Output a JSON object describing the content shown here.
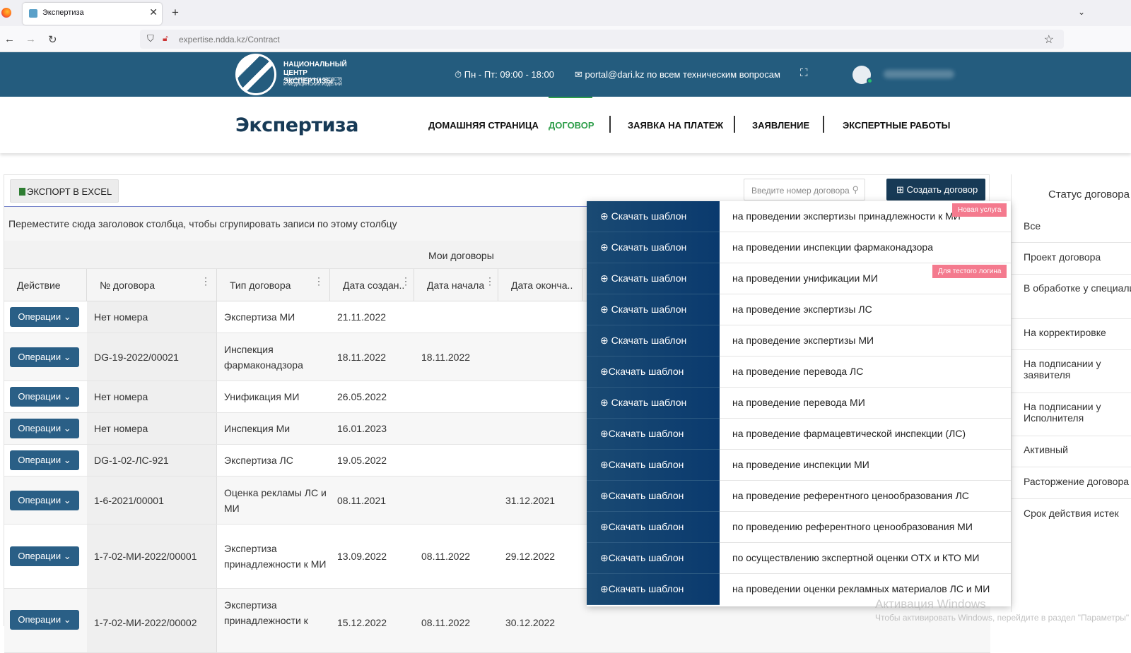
{
  "browser": {
    "tab_title": "Экспертиза",
    "url": "expertise.ndda.kz/Contract"
  },
  "header": {
    "logo_line1": "НАЦИОНАЛЬНЫЙ",
    "logo_line2": "ЦЕНТР ЭКСПЕРТИЗЫ",
    "logo_line3": "ЛЕКАРСТВЕННЫХ СРЕДСТВ",
    "logo_line4": "И МЕДИЦИНСКИХ ИЗДЕЛИЙ",
    "hours": "Пн - Пт: 09:00 - 18:00",
    "email": "portal@dari.kz по всем техническим вопросам"
  },
  "nav": {
    "brand": "Экспертиза",
    "items": [
      "ДОМАШНЯЯ СТРАНИЦА",
      "ДОГОВОР",
      "ЗАЯВКА НА ПЛАТЕЖ",
      "ЗАЯВЛЕНИЕ",
      "ЭКСПЕРТНЫЕ РАБОТЫ"
    ],
    "active": "ДОГОВОР",
    "active_color": "#2e9e4a"
  },
  "toolbar": {
    "export_label": "ЭКСПОРТ В EXCEL",
    "search_placeholder": "Введите номер договора",
    "create_label": "Создать договор"
  },
  "grid": {
    "group_hint": "Переместите сюда заголовок столбца, чтобы сгрупировать записи по этому столбцу",
    "caption": "Мои договоры",
    "columns": [
      "Действие",
      "№ договора",
      "Тип договора",
      "Дата создан..",
      "Дата начала",
      "Дата оконча.."
    ],
    "operations_label": "Операции",
    "rows": [
      {
        "number": "Нет номера",
        "type": "Экспертиза МИ",
        "created": "21.11.2022",
        "start": "",
        "end": ""
      },
      {
        "number": "DG-19-2022/00021",
        "type": "Инспекция фармаконадзора",
        "created": "18.11.2022",
        "start": "18.11.2022",
        "end": ""
      },
      {
        "number": "Нет номера",
        "type": "Унификация МИ",
        "created": "26.05.2022",
        "start": "",
        "end": ""
      },
      {
        "number": "Нет номера",
        "type": "Инспекция Ми",
        "created": "16.01.2023",
        "start": "",
        "end": ""
      },
      {
        "number": "DG-1-02-ЛС-921",
        "type": "Экспертиза ЛС",
        "created": "19.05.2022",
        "start": "",
        "end": ""
      },
      {
        "number": "1-6-2021/00001",
        "type": "Оценка рекламы ЛС и МИ",
        "created": "08.11.2021",
        "start": "",
        "end": "31.12.2021"
      },
      {
        "number": "1-7-02-МИ-2022/00001",
        "type": "Экспертиза принадлежности к МИ",
        "created": "13.09.2022",
        "start": "08.11.2022",
        "end": "29.12.2022"
      },
      {
        "number": "1-7-02-МИ-2022/00002",
        "type": "Экспертиза принадлежности к",
        "created": "15.12.2022",
        "start": "08.11.2022",
        "end": "30.12.2022"
      }
    ]
  },
  "dropdown": {
    "button_label": "Скачать шаблон",
    "items": [
      "на проведении экспертизы принадлежности к МИ",
      "на проведении инспекции фармаконадзора",
      "на проведении унификации МИ",
      "на проведение экспертизы ЛС",
      "на проведение экспертизы МИ",
      "на проведение перевода ЛС",
      "на проведение перевода МИ",
      "на проведение фармацевтической инспекции (ЛС)",
      "на проведение инспекции МИ",
      "на проведение референтного ценообразования ЛС",
      "по проведению референтного ценообразования МИ",
      "по осуществлению экспертной оценки ОТХ и КТО МИ",
      "на проведении оценки рекламных материалов ЛС и МИ"
    ],
    "badge_new": "Новая услуга",
    "badge_test": "Для тестого логина",
    "badge_color": "#f47a8e"
  },
  "status_panel": {
    "title": "Статус договора",
    "items": [
      "Все",
      "Проект договора",
      "В обработке у специалиста",
      "На корректировке",
      "На подписании у заявителя",
      "На подписании у Исполнителя",
      "Активный",
      "Расторжение договора",
      "Срок действия истек"
    ]
  },
  "watermark": {
    "line1": "Активация Windows",
    "line2": "Чтобы активировать Windows, перейдите в раздел \"Параметры\""
  }
}
